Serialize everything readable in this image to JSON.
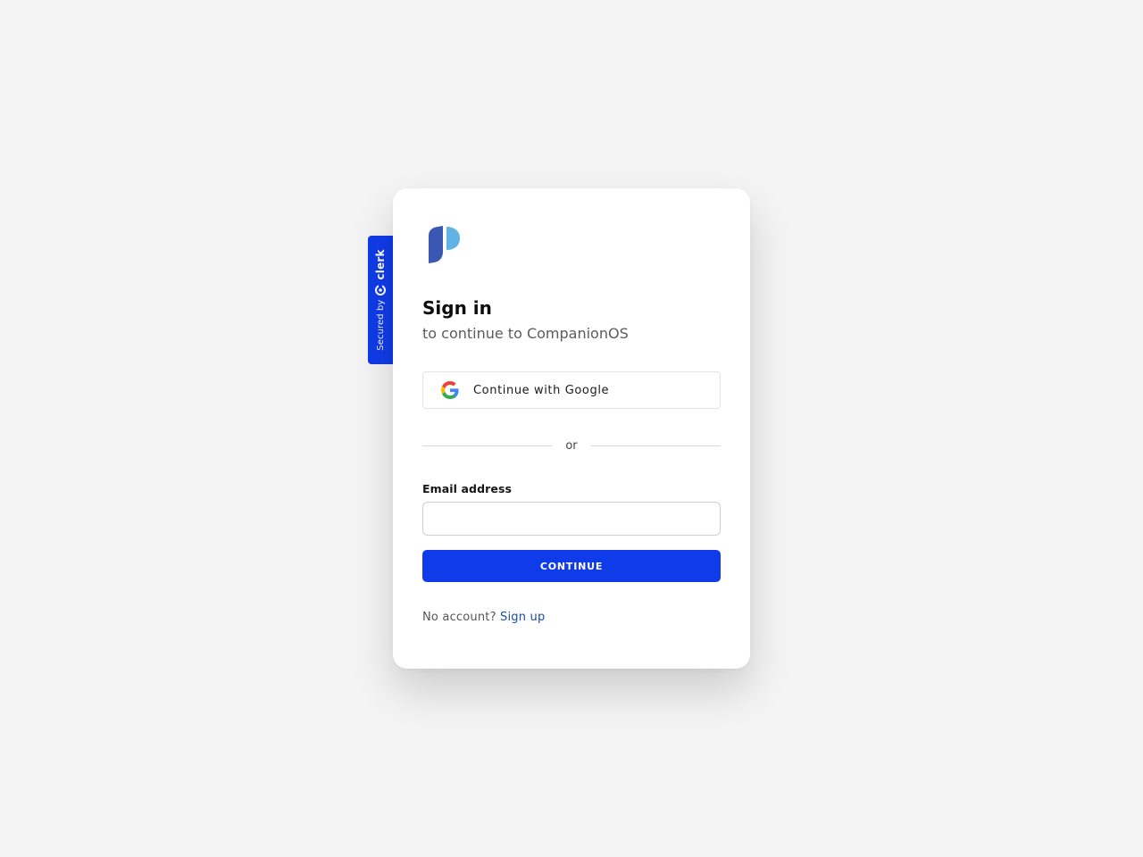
{
  "secured_badge": {
    "prefix": "Secured by",
    "brand": "clerk"
  },
  "card": {
    "title": "Sign in",
    "subtitle": "to continue to CompanionOS"
  },
  "google": {
    "label": "Continue with Google",
    "icon": "google-icon"
  },
  "divider": {
    "text": "or"
  },
  "email": {
    "label": "Email address",
    "value": "",
    "placeholder": ""
  },
  "continue": {
    "label": "CONTINUE"
  },
  "footer": {
    "prompt": "No account?",
    "link": "Sign up"
  },
  "colors": {
    "accent": "#103be9",
    "link": "#1c4ba8",
    "background": "#f4f4f4",
    "logo_dark": "#3a57b4",
    "logo_light": "#5fb3e6"
  }
}
